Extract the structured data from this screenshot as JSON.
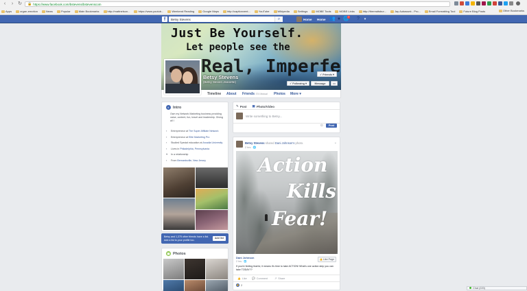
{
  "browser": {
    "url": "https://www.facebook.com/bstevens/bstevenscom",
    "bookmarks": [
      "Apps",
      "organ-emotion",
      "News",
      "Popular",
      "Main Bookmarks",
      "http://mattnelson...",
      "https://www.youtub...",
      "Weekend Reading",
      "Google Maps",
      "http://captionvent...",
      "YouTube",
      "Wikipedia",
      "Settings",
      "MOBE Tools",
      "MOBE Links",
      "http://thereaitsbur...",
      "Jay Aubassek - Pro...",
      "Email Formatting Tool",
      "Future Blog Posts"
    ],
    "other_bookmarks": "Other Bookmarks"
  },
  "fbnav": {
    "logo": "f",
    "search_value": "Betsy Stevens",
    "user_name": "Home",
    "home": "Home",
    "notif_count": "7"
  },
  "profile": {
    "cover_line1": "Just Be Yourself.",
    "cover_line2": "Let people see the",
    "cover_line3": "Real, Imperfect,",
    "name": "Betsy Stevens",
    "subtitle": "(Betsy Steven Jeanette)",
    "friends_button": "✓ Friends ▾",
    "following_button": "✓ Following ▾",
    "message_button": "Message",
    "more_button": "•••",
    "tabs": [
      {
        "label": "Timeline"
      },
      {
        "label": "About"
      },
      {
        "label": "Friends",
        "extra": "374 Mutual"
      },
      {
        "label": "Photos"
      },
      {
        "label": "More ▾"
      }
    ]
  },
  "intro": {
    "title": "Intro",
    "bio": "Own my Network Marketing business providing value, content, fun, travel and leadership. Giving all I",
    "items": [
      {
        "icon": "briefcase-icon",
        "glyph": "▪",
        "text": "Entrepreneur at ",
        "link": "The Super Affiliate Network"
      },
      {
        "icon": "briefcase-icon",
        "glyph": "▪",
        "text": "Entrepreneur at ",
        "link": "Elite Marketing Pro"
      },
      {
        "icon": "graduation-icon",
        "glyph": "▪",
        "text": "Studied Special education at ",
        "link": "Arcadia University"
      },
      {
        "icon": "home-icon",
        "glyph": "▪",
        "text": "Lives in ",
        "link": "Philadelphia, Pennsylvania"
      },
      {
        "icon": "heart-icon",
        "glyph": "♥",
        "text": "In a relationship",
        "link": ""
      },
      {
        "icon": "location-icon",
        "glyph": "▪",
        "text": "From ",
        "link": "Bernardsville, New Jersey"
      }
    ]
  },
  "add_friend": {
    "text": "Betsy and 1,375 other friends have a list. Add a list to your profile too.",
    "button": "Add list"
  },
  "photos": {
    "title": "Photos"
  },
  "composer": {
    "post_tab": "Post",
    "photo_tab": "Photo/Video",
    "placeholder": "Write something to Betsy...",
    "post_button": "Post"
  },
  "post": {
    "author": "Betsy Stevens",
    "action": " shared ",
    "shared_from": "Dani Johnson's",
    "object": " photo.",
    "time": "2 hrs · 🌐",
    "image_words": [
      "Action",
      "Kills",
      "Fear!"
    ],
    "page_name": "Dani Johnson",
    "page_time": "2 hrs · 🌐",
    "like_page": "👍 Like Page",
    "caption": "If you're feeling fearful, it means it's time to take ACTION! What's one action step you can take TODAY??",
    "like": "Like",
    "comment": "Comment",
    "share": "Share",
    "reactions": "2"
  },
  "chat": {
    "label": "Chat (220)"
  }
}
